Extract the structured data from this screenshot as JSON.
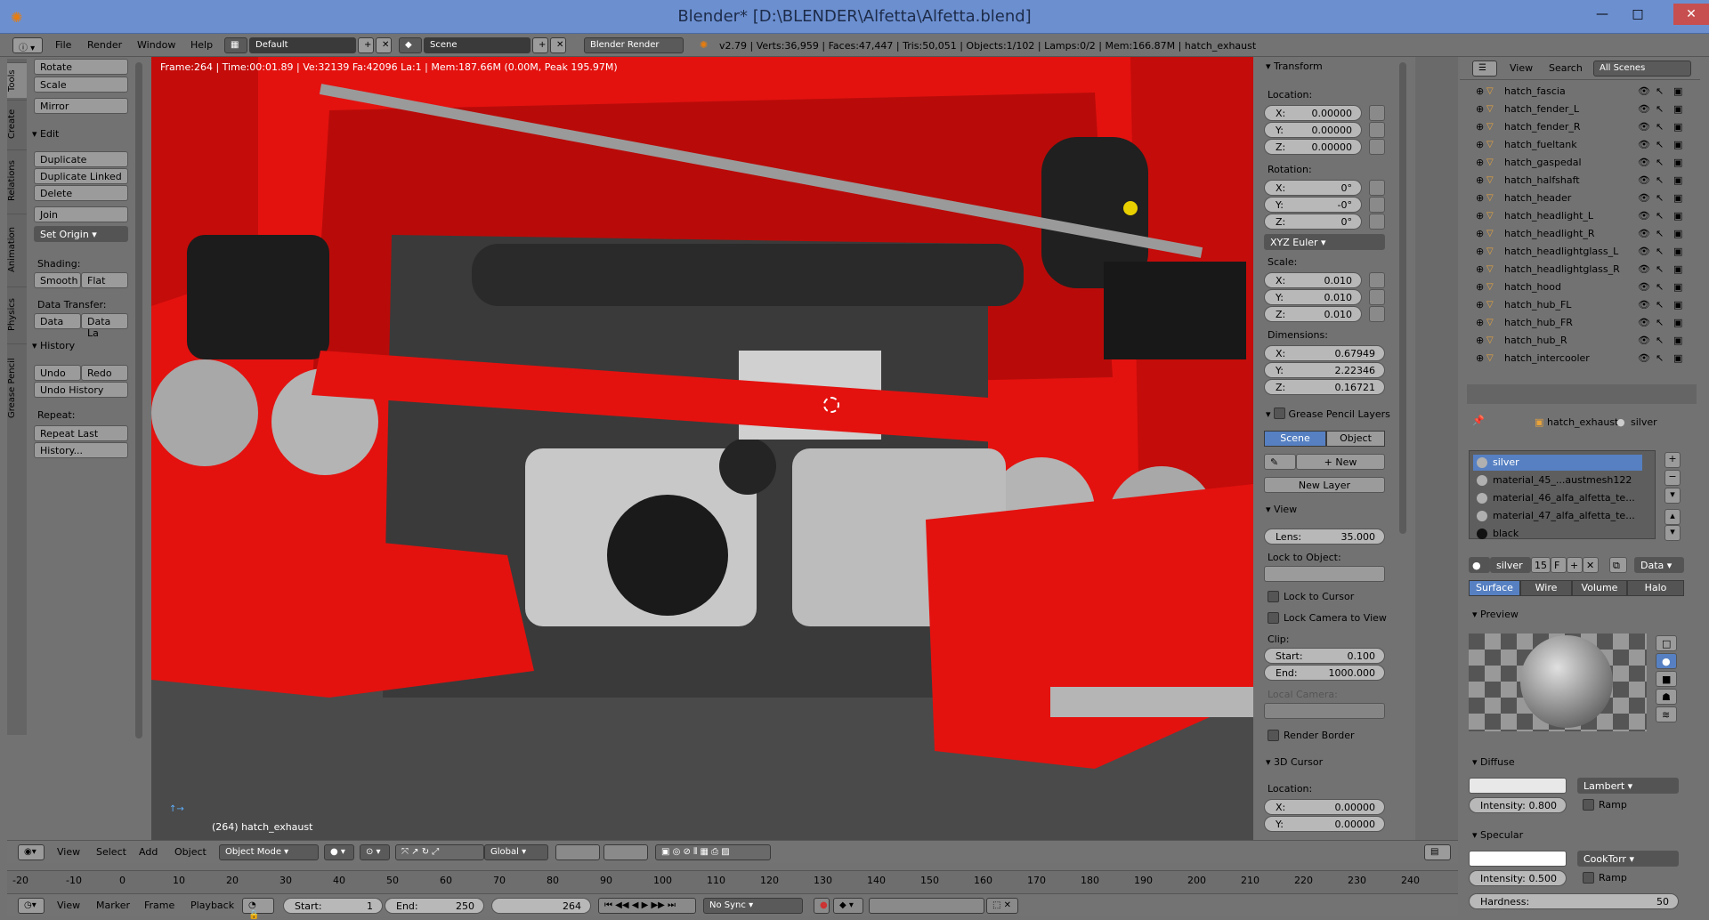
{
  "window": {
    "title": "Blender* [D:\\BLENDER\\Alfetta\\Alfetta.blend]"
  },
  "menu": {
    "items": [
      "File",
      "Render",
      "Window",
      "Help"
    ],
    "layout": "Default",
    "scene": "Scene",
    "engine": "Blender Render",
    "status": "v2.79 | Verts:36,959 | Faces:47,447 | Tris:50,051 | Objects:1/102 | Lamps:0/2 | Mem:166.87M | hatch_exhaust"
  },
  "tool_tabs": [
    "Tools",
    "Create",
    "Relations",
    "Animation",
    "Physics",
    "Grease Pencil"
  ],
  "toolshelf": {
    "transform_buttons": [
      "Rotate",
      "Scale",
      "Mirror"
    ],
    "edit_title": "Edit",
    "edit_buttons": [
      "Duplicate",
      "Duplicate Linked",
      "Delete",
      "Join",
      "Set Origin"
    ],
    "shading_label": "Shading:",
    "smooth": "Smooth",
    "flat": "Flat",
    "data_transfer_label": "Data Transfer:",
    "data": "Data",
    "data_la": "Data La",
    "history_title": "History",
    "undo": "Undo",
    "redo": "Redo",
    "undo_history": "Undo History",
    "repeat_label": "Repeat:",
    "repeat_last": "Repeat Last",
    "history_dots": "History..."
  },
  "viewport": {
    "info": "Frame:264 | Time:00:01.89 | Ve:32139 Fa:42096 La:1 | Mem:187.66M (0.00M, Peak 195.97M)",
    "object_label": "(264) hatch_exhaust"
  },
  "npanel": {
    "transform_title": "Transform",
    "location_label": "Location:",
    "location": [
      {
        "axis": "X:",
        "value": "0.00000"
      },
      {
        "axis": "Y:",
        "value": "0.00000"
      },
      {
        "axis": "Z:",
        "value": "0.00000"
      }
    ],
    "rotation_label": "Rotation:",
    "rotation": [
      {
        "axis": "X:",
        "value": "0°"
      },
      {
        "axis": "Y:",
        "value": "-0°"
      },
      {
        "axis": "Z:",
        "value": "0°"
      }
    ],
    "rotation_mode": "XYZ Euler",
    "scale_label": "Scale:",
    "scale": [
      {
        "axis": "X:",
        "value": "0.010"
      },
      {
        "axis": "Y:",
        "value": "0.010"
      },
      {
        "axis": "Z:",
        "value": "0.010"
      }
    ],
    "dimensions_label": "Dimensions:",
    "dimensions": [
      {
        "axis": "X:",
        "value": "0.67949"
      },
      {
        "axis": "Y:",
        "value": "2.22346"
      },
      {
        "axis": "Z:",
        "value": "0.16721"
      }
    ],
    "grease_title": "Grease Pencil Layers",
    "gp_scene": "Scene",
    "gp_object": "Object",
    "gp_new": "New",
    "gp_new_layer": "New Layer",
    "view_title": "View",
    "lens_label": "Lens:",
    "lens": "35.000",
    "lock_to_object": "Lock to Object:",
    "lock_to_cursor": "Lock to Cursor",
    "lock_camera": "Lock Camera to View",
    "clip_label": "Clip:",
    "clip_start_label": "Start:",
    "clip_start": "0.100",
    "clip_end_label": "End:",
    "clip_end": "1000.000",
    "local_camera": "Local Camera:",
    "render_border": "Render Border",
    "cursor_title": "3D Cursor",
    "cursor_location": "Location:",
    "cursor": [
      {
        "axis": "X:",
        "value": "0.00000"
      },
      {
        "axis": "Y:",
        "value": "0.00000"
      }
    ]
  },
  "outliner": {
    "view": "View",
    "search": "Search",
    "scenes": "All Scenes",
    "items": [
      "hatch_fascia",
      "hatch_fender_L",
      "hatch_fender_R",
      "hatch_fueltank",
      "hatch_gaspedal",
      "hatch_halfshaft",
      "hatch_header",
      "hatch_headlight_L",
      "hatch_headlight_R",
      "hatch_headlightglass_L",
      "hatch_headlightglass_R",
      "hatch_hood",
      "hatch_hub_FL",
      "hatch_hub_FR",
      "hatch_hub_R",
      "hatch_intercooler"
    ]
  },
  "properties": {
    "breadcrumb_obj": "hatch_exhaust",
    "breadcrumb_mat": "silver",
    "materials": [
      {
        "name": "silver",
        "color": "#b0b0b0"
      },
      {
        "name": "material_45_...austmesh122",
        "color": "#b0b0b0"
      },
      {
        "name": "material_46_alfa_alfetta_te...",
        "color": "#b0b0b0"
      },
      {
        "name": "material_47_alfa_alfetta_te...",
        "color": "#b0b0b0"
      },
      {
        "name": "black",
        "color": "#111111"
      }
    ],
    "mat_name": "silver",
    "users": "15",
    "fake": "F",
    "data": "Data",
    "tabs": [
      "Surface",
      "Wire",
      "Volume",
      "Halo"
    ],
    "preview_title": "Preview",
    "diffuse_title": "Diffuse",
    "diffuse_shader": "Lambert",
    "diffuse_intensity_label": "Intensity:",
    "diffuse_intensity": "0.800",
    "ramp": "Ramp",
    "specular_title": "Specular",
    "specular_shader": "CookTorr",
    "specular_intensity": "0.500",
    "hardness_label": "Hardness:",
    "hardness": "50"
  },
  "viewport_header": {
    "view": "View",
    "select": "Select",
    "add": "Add",
    "object": "Object",
    "mode": "Object Mode",
    "orientation": "Global"
  },
  "timeline": {
    "ticks": [
      "-20",
      "-10",
      "0",
      "10",
      "20",
      "30",
      "40",
      "50",
      "60",
      "70",
      "80",
      "90",
      "100",
      "110",
      "120",
      "130",
      "140",
      "150",
      "160",
      "170",
      "180",
      "190",
      "200",
      "210",
      "220",
      "230",
      "240"
    ],
    "view": "View",
    "marker": "Marker",
    "frame": "Frame",
    "playback": "Playback",
    "start_label": "Start:",
    "start": "1",
    "end_label": "End:",
    "end": "250",
    "current": "264",
    "sync": "No Sync"
  },
  "colors": {
    "accent": "#5680c2",
    "car_red": "#e3120f",
    "title_bar": "#6c8fd0",
    "close": "#c74f4f"
  }
}
